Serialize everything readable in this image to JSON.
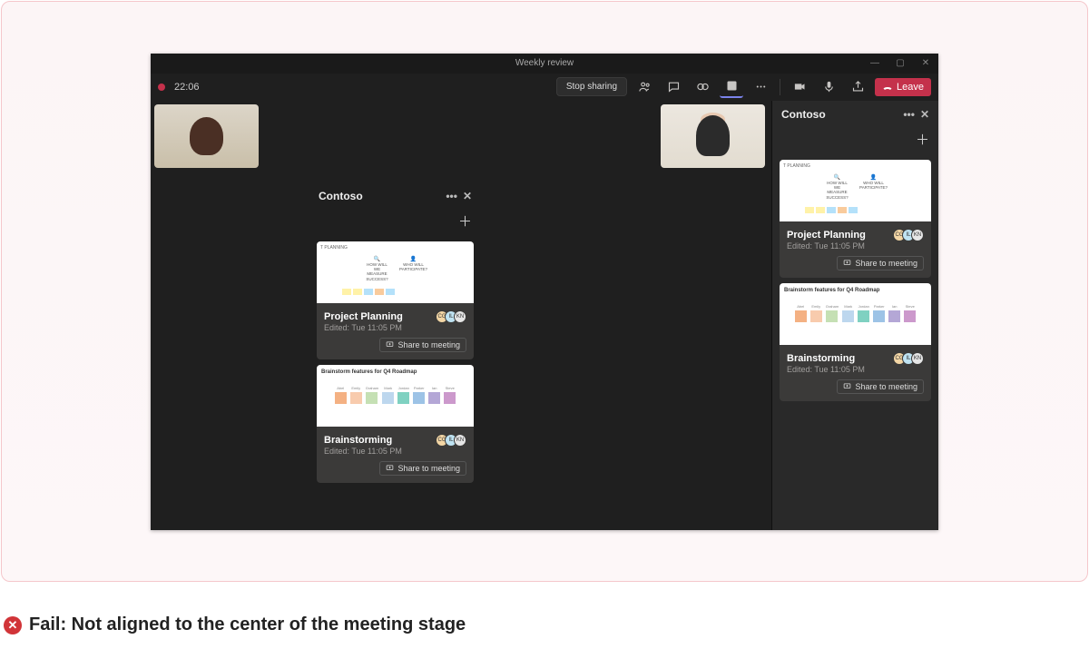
{
  "meeting": {
    "title": "Weekly review",
    "timer": "22:06",
    "stop_sharing": "Stop sharing",
    "leave": "Leave"
  },
  "panel_title": "Contoso",
  "cards": [
    {
      "thumb_heading": "T PLANNING",
      "thumb_label_a": "HOW WILL WE MEASURE SUCCESS?",
      "thumb_label_b": "WHO WILL PARTICIPATE?",
      "title": "Project Planning",
      "edited": "Edited: Tue 11:05 PM",
      "share_label": "Share to meeting",
      "presence": [
        "CG",
        "IL",
        "KN"
      ]
    },
    {
      "thumb_heading": "Brainstorm features for Q4 Roadmap",
      "swatch_labels": [
        "Abel",
        "Emily",
        "Graham",
        "Mark",
        "Jordan",
        "Parker",
        "Ian",
        "Steve"
      ],
      "title": "Brainstorming",
      "edited": "Edited: Tue 11:05 PM",
      "share_label": "Share to meeting",
      "presence": [
        "CG",
        "IL",
        "KN"
      ]
    }
  ],
  "swatch_colors": [
    "#f4b183",
    "#f8cbad",
    "#c5e0b4",
    "#bdd7ee",
    "#7fd1c1",
    "#9dc3e6",
    "#b4a7d6",
    "#cc99cc"
  ],
  "note_colors": [
    "#fff2a8",
    "#fff2a8",
    "#b4e1fa",
    "#f9cb9c",
    "#b4e1fa"
  ],
  "caption": "Fail: Not aligned to the center of the meeting stage"
}
